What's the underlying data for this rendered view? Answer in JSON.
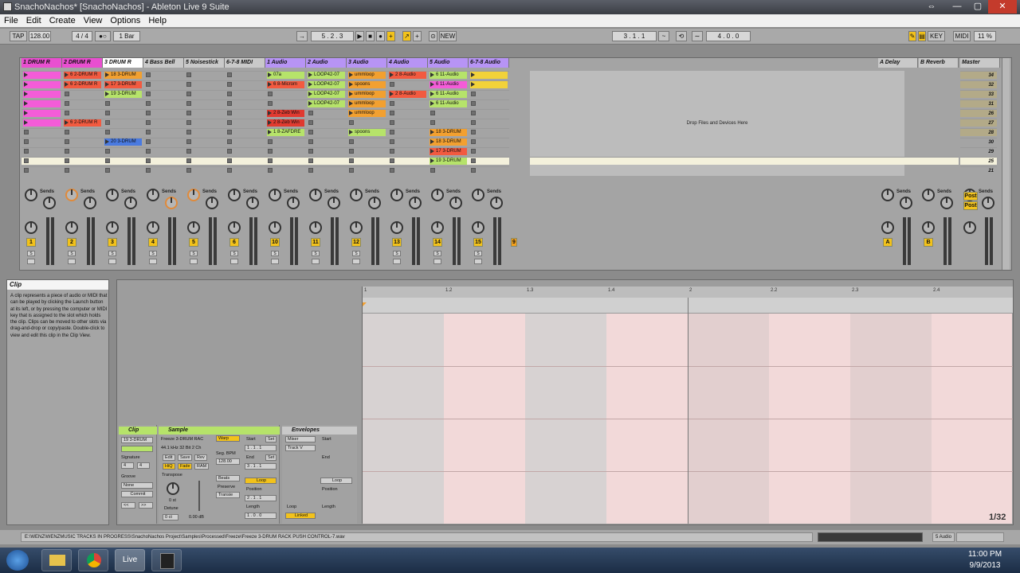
{
  "window": {
    "title": "SnachoNachos*  [SnachoNachos] - Ableton Live 9 Suite",
    "min": "—",
    "max": "▢",
    "close": "✕",
    "restore": "⇔"
  },
  "menu": [
    "File",
    "Edit",
    "Create",
    "View",
    "Options",
    "Help"
  ],
  "transport": {
    "tap": "TAP",
    "tempo": "128.00",
    "sig": "4 / 4",
    "metro": "●○",
    "quant": "1 Bar",
    "pos": "5 .  2 .  3",
    "loop_start": "3 .  1 .  1",
    "loop_len": "4 .  0 .  0",
    "new": "NEW",
    "key": "KEY",
    "midi": "MIDI",
    "cpu": "11 %"
  },
  "tracks": [
    {
      "name": "1 DRUM R",
      "color": "#e94fd0"
    },
    {
      "name": "2 DRUM R",
      "color": "#e94fd0"
    },
    {
      "name": "3 DRUM R",
      "color": "#ffffff"
    },
    {
      "name": "4 Bass Bell",
      "color": "#c9c9c9"
    },
    {
      "name": "5 Noisestick",
      "color": "#c9c9c9"
    },
    {
      "name": "6-7-8 MIDI",
      "color": "#c9c9c9"
    },
    {
      "name": "1 Audio",
      "color": "#b794f5"
    },
    {
      "name": "2 Audio",
      "color": "#b794f5"
    },
    {
      "name": "3 Audio",
      "color": "#b794f5"
    },
    {
      "name": "4 Audio",
      "color": "#b794f5"
    },
    {
      "name": "5 Audio",
      "color": "#b794f5"
    },
    {
      "name": "6-7-8 Audio",
      "color": "#b794f5"
    }
  ],
  "returns": [
    {
      "name": "A Delay"
    },
    {
      "name": "B Reverb"
    },
    {
      "name": "Master"
    }
  ],
  "clips": [
    {
      "t": 0,
      "r": 0,
      "n": "",
      "c": "#f45cd8"
    },
    {
      "t": 0,
      "r": 1,
      "n": "",
      "c": "#f45cd8"
    },
    {
      "t": 0,
      "r": 2,
      "n": "",
      "c": "#f45cd8"
    },
    {
      "t": 0,
      "r": 3,
      "n": "",
      "c": "#f45cd8"
    },
    {
      "t": 0,
      "r": 4,
      "n": "",
      "c": "#f45cd8"
    },
    {
      "t": 0,
      "r": 5,
      "n": "",
      "c": "#f45cd8"
    },
    {
      "t": 1,
      "r": 0,
      "n": "6 2-DRUM R",
      "c": "#f25a40"
    },
    {
      "t": 1,
      "r": 1,
      "n": "6 2-DRUM R",
      "c": "#f25a40"
    },
    {
      "t": 1,
      "r": 5,
      "n": "6 2-DRUM R",
      "c": "#f25a40"
    },
    {
      "t": 2,
      "r": 0,
      "n": "18 3-DRUM",
      "c": "#f2a030"
    },
    {
      "t": 2,
      "r": 1,
      "n": "17 3-DRUM",
      "c": "#f25a40"
    },
    {
      "t": 2,
      "r": 2,
      "n": "19 3-DRUM",
      "c": "#b6e36a"
    },
    {
      "t": 2,
      "r": 7,
      "n": "20 3-DRUM",
      "c": "#4a7ae0"
    },
    {
      "t": 6,
      "r": 0,
      "n": "07a",
      "c": "#b6e36a"
    },
    {
      "t": 6,
      "r": 1,
      "n": "6 8-Microm",
      "c": "#f25a40"
    },
    {
      "t": 6,
      "r": 4,
      "n": "2 8-Zeb Win",
      "c": "#e03a30"
    },
    {
      "t": 6,
      "r": 5,
      "n": "2 8-Zeb Win",
      "c": "#e03a30"
    },
    {
      "t": 6,
      "r": 6,
      "n": "1 8-ZAFDRE",
      "c": "#b6e36a"
    },
    {
      "t": 7,
      "r": 0,
      "n": "LOOP42-07",
      "c": "#b6e36a"
    },
    {
      "t": 7,
      "r": 1,
      "n": "LOOP42-07",
      "c": "#b6e36a"
    },
    {
      "t": 7,
      "r": 2,
      "n": "LOOP42-07",
      "c": "#b6e36a"
    },
    {
      "t": 7,
      "r": 3,
      "n": "LOOP42-07",
      "c": "#b6e36a"
    },
    {
      "t": 8,
      "r": 0,
      "n": "ummloop",
      "c": "#f2a030"
    },
    {
      "t": 8,
      "r": 1,
      "n": "spoons",
      "c": "#f2a030"
    },
    {
      "t": 8,
      "r": 2,
      "n": "ummloop",
      "c": "#f2a030"
    },
    {
      "t": 8,
      "r": 3,
      "n": "ummloop",
      "c": "#f2a030"
    },
    {
      "t": 8,
      "r": 4,
      "n": "ummloop",
      "c": "#f2a030"
    },
    {
      "t": 8,
      "r": 6,
      "n": "spoons",
      "c": "#b6e36a"
    },
    {
      "t": 9,
      "r": 0,
      "n": "2 8-Audio",
      "c": "#f25a40"
    },
    {
      "t": 9,
      "r": 2,
      "n": "2 8-Audio",
      "c": "#f25a40"
    },
    {
      "t": 10,
      "r": 0,
      "n": "6 11-Audio",
      "c": "#b6e36a"
    },
    {
      "t": 10,
      "r": 1,
      "n": "6 11-Audio",
      "c": "#f45cd8"
    },
    {
      "t": 10,
      "r": 2,
      "n": "6 11-Audio",
      "c": "#b6e36a"
    },
    {
      "t": 10,
      "r": 3,
      "n": "6 11-Audio",
      "c": "#b6e36a"
    },
    {
      "t": 10,
      "r": 6,
      "n": "18 3-DRUM",
      "c": "#f2a030"
    },
    {
      "t": 10,
      "r": 7,
      "n": "18 3-DRUM",
      "c": "#f2a030"
    },
    {
      "t": 10,
      "r": 8,
      "n": "17 3-DRUM",
      "c": "#f25a40"
    },
    {
      "t": 10,
      "r": 9,
      "n": "19 3-DRUM",
      "c": "#b6e36a"
    },
    {
      "t": 11,
      "r": 0,
      "n": "",
      "c": "#f2d23a"
    },
    {
      "t": 11,
      "r": 1,
      "n": "",
      "c": "#f2d23a"
    }
  ],
  "scenes": [
    "34",
    "32",
    "33",
    "31",
    "26",
    "27",
    "28",
    "30",
    "29",
    "25",
    "21"
  ],
  "drop_text": "Drop Files and Devices Here",
  "sends_label": "Sends",
  "post": "Post",
  "track_numbers": [
    "1",
    "2",
    "3",
    "4",
    "5",
    "6",
    "10",
    "11",
    "12",
    "13",
    "14",
    "15",
    "9"
  ],
  "return_letters": [
    "A",
    "B"
  ],
  "info": {
    "title": "Clip",
    "text": "A clip represents a piece of audio or MIDI that can be played by clicking the Launch button at its left, or by pressing the computer or MIDI key that is assigned to the slot which holds the clip. Clips can be moved to other slots via drag-and-drop or copy/paste. Double-click to view and edit this clip in the Clip View."
  },
  "clippanel": {
    "title": "Clip",
    "name": "19 3-DRUM",
    "signature": "Signature",
    "sig_n": "4",
    "sig_d": "4",
    "groove": "Groove",
    "none": "None",
    "commit": "Commit"
  },
  "samplepanel": {
    "title": "Sample",
    "file": "Freeze 3-DRUM RAC",
    "info": "44.1 kHz 32 Bit 2 Ch",
    "warp": "Warp",
    "edit": "Edit",
    "save": "Save",
    "rev": "Rev",
    "hiq": "HiQ",
    "fade": "Fade",
    "ram": "RAM",
    "transpose": "Transpose",
    "semi": "0 st",
    "detune": "Detune",
    "cents": "0 ct",
    "gain": "0.00 dB",
    "segbpm": "Seg. BPM",
    "bpm": "128.00",
    "beats": "Beats",
    "preserve": "Preserve",
    "transients": "Transie",
    "start": "Start",
    "end": "End",
    "loop": "Loop",
    "position": "Position",
    "length": "Length",
    "set": "Set"
  },
  "envpanel": {
    "title": "Envelopes",
    "mixer": "Mixer",
    "trackv": "Track V",
    "start": "Start",
    "end": "End",
    "loop": "Loop",
    "position": "Position",
    "length": "Length",
    "linked": "Linked"
  },
  "ruler": [
    "1",
    "1.2",
    "1.3",
    "1.4",
    "2",
    "2.2",
    "2.3",
    "2.4"
  ],
  "zoom": "1/32",
  "statusbar": {
    "path": "E:\\WENZ\\WENZMUSIC TRACKS IN PROGRESS\\SnachoNachos Project\\Samples\\Processed\\Freeze\\Freeze 3-DRUM RACK PUSH CONTROL-7.wav",
    "track": "5 Audio"
  },
  "taskbar": {
    "time": "11:00 PM",
    "date": "9/9/2013",
    "live": "Live"
  }
}
